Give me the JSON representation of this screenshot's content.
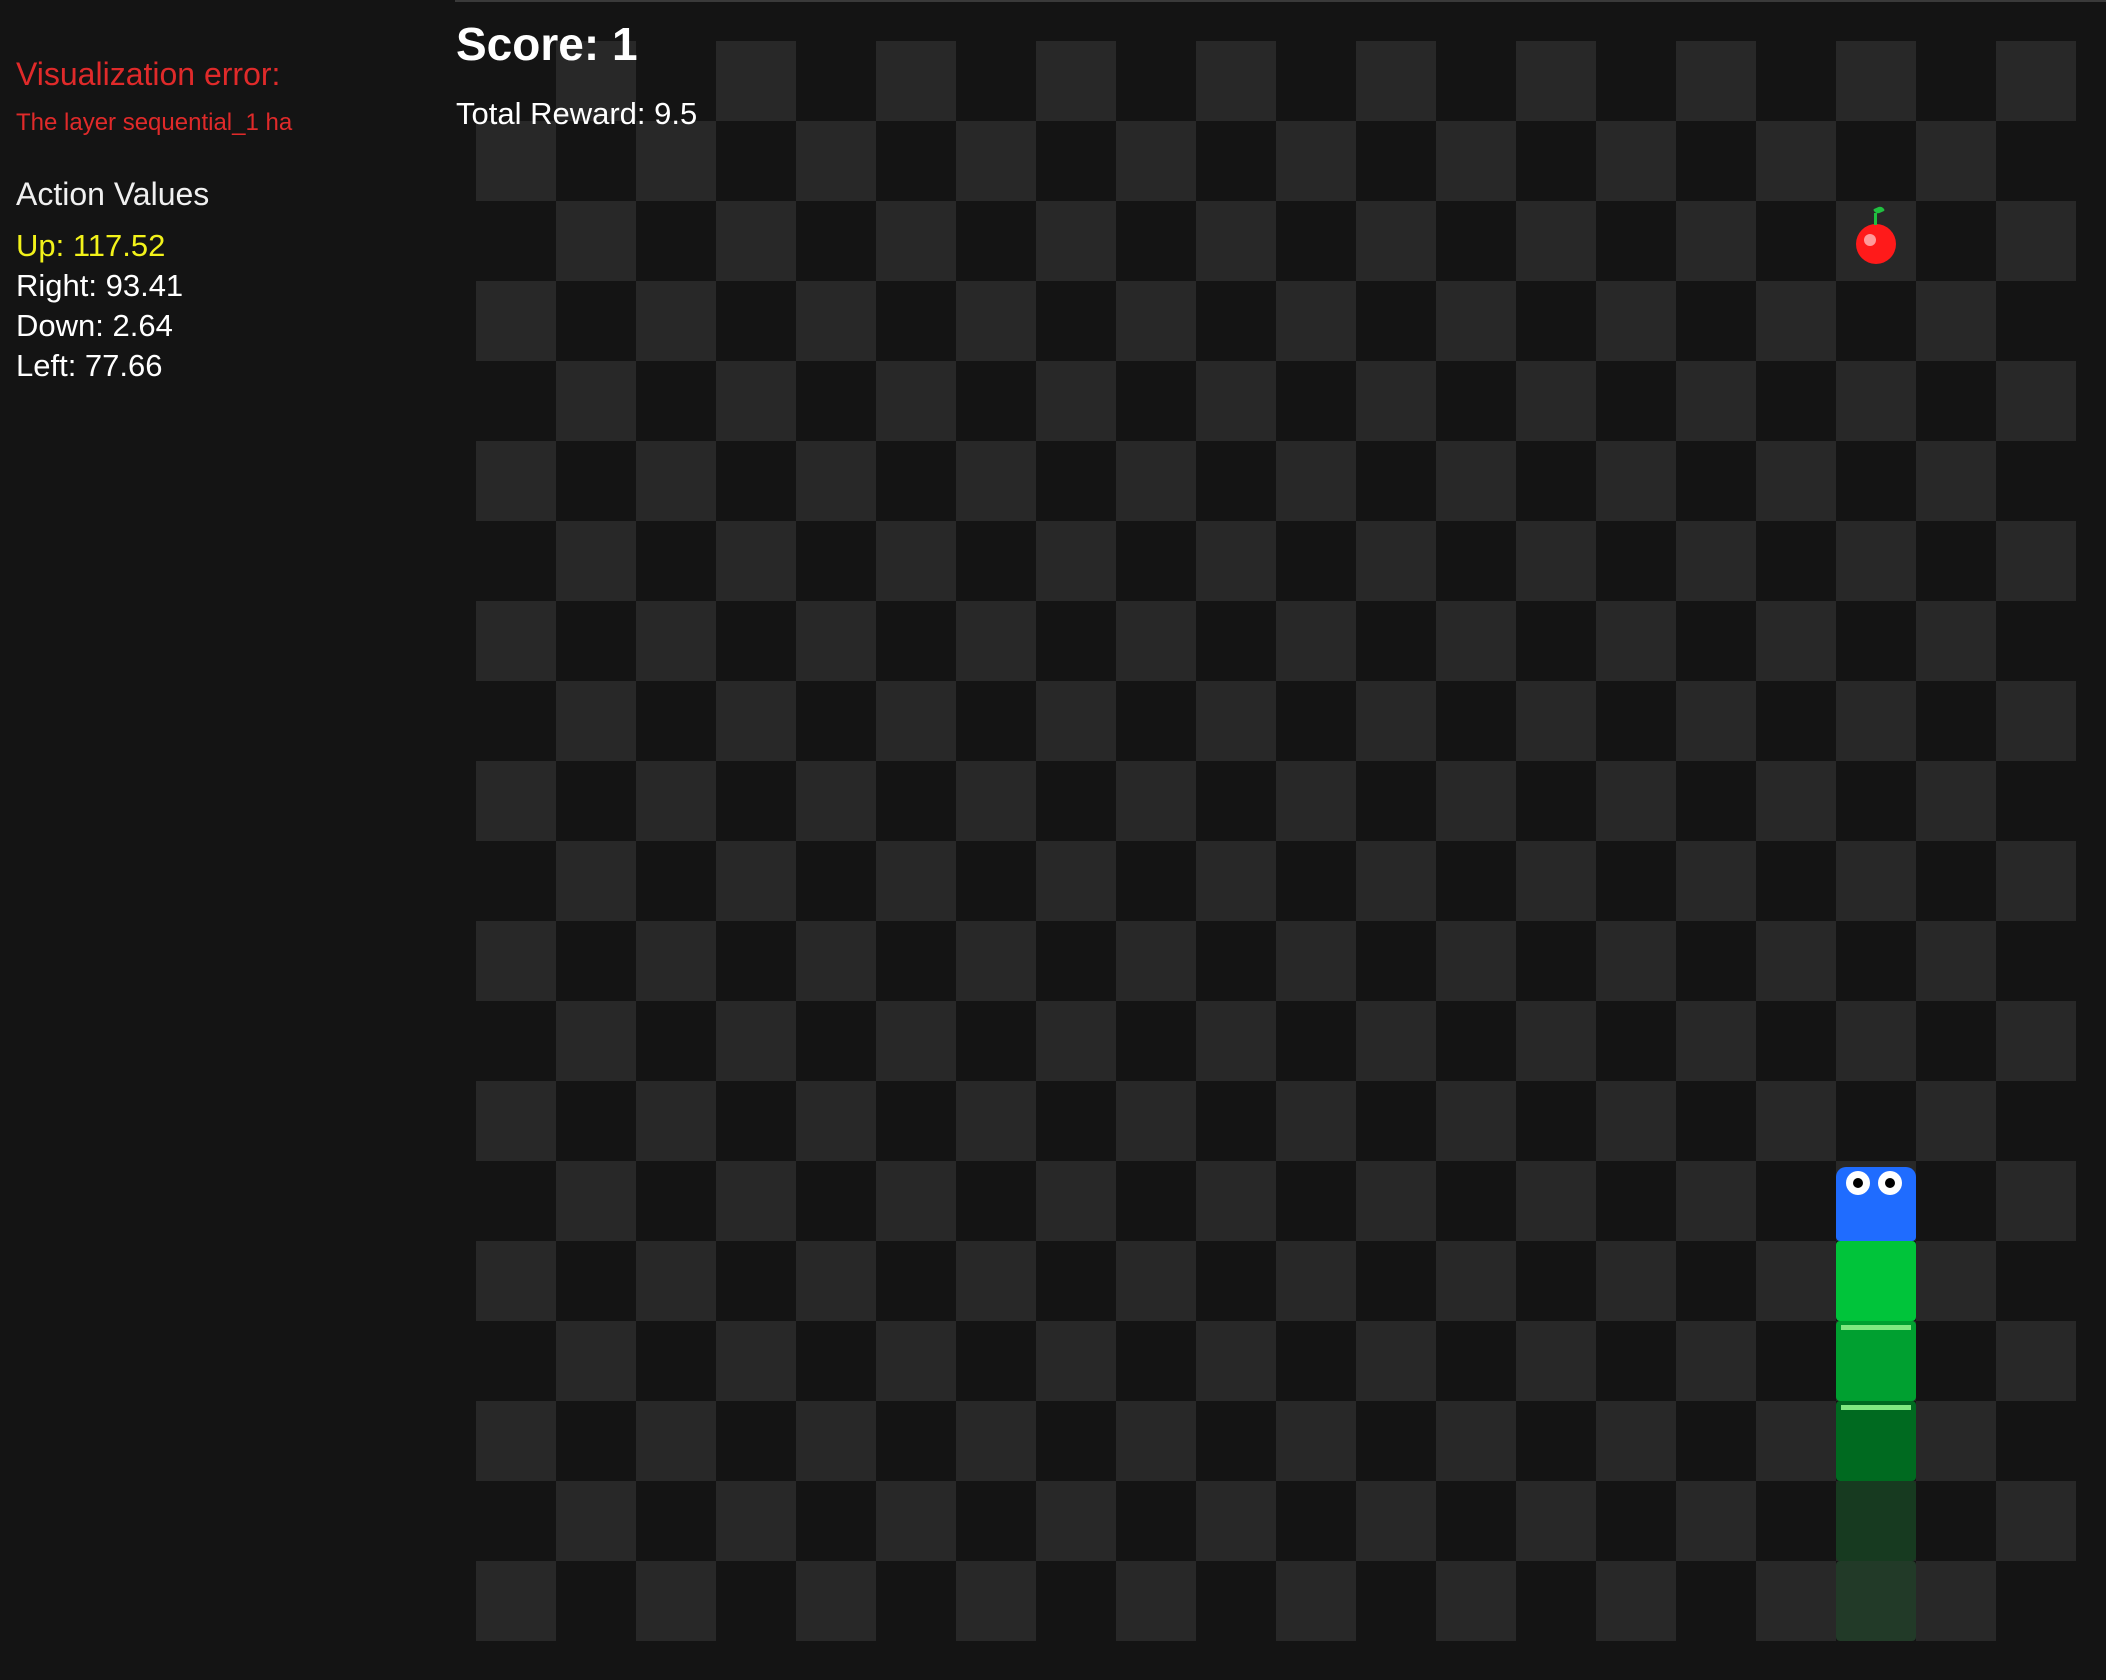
{
  "sidebar": {
    "error_title": "Visualization error:",
    "error_message": "The layer sequential_1 ha",
    "action_values_title": "Action Values",
    "actions": [
      {
        "label": "Up: 117.52",
        "best": true
      },
      {
        "label": "Right: 93.41",
        "best": false
      },
      {
        "label": "Down: 2.64",
        "best": false
      },
      {
        "label": "Left: 77.66",
        "best": false
      }
    ]
  },
  "hud": {
    "score": "Score: 1",
    "total_reward": "Total Reward: 9.5"
  },
  "game": {
    "grid": {
      "cols": 20,
      "rows": 20
    },
    "food": {
      "col": 17,
      "row": 2,
      "icon": "apple-icon"
    },
    "snake": [
      {
        "col": 17,
        "row": 14,
        "part": "head",
        "color": "#1f6cff"
      },
      {
        "col": 17,
        "row": 15,
        "part": "body",
        "color": "#00c43a"
      },
      {
        "col": 17,
        "row": 16,
        "part": "body",
        "color": "#00a030"
      },
      {
        "col": 17,
        "row": 17,
        "part": "body",
        "color": "#006a20"
      },
      {
        "col": 17,
        "row": 18,
        "part": "trail",
        "color": "#173a20"
      },
      {
        "col": 17,
        "row": 19,
        "part": "trail",
        "color": "#223a28"
      }
    ],
    "colors": {
      "board_dark": "#141414",
      "board_light": "#282828",
      "error": "#e02a2a",
      "best_action": "#f2f21a",
      "apple": "#ff1a1a"
    }
  }
}
